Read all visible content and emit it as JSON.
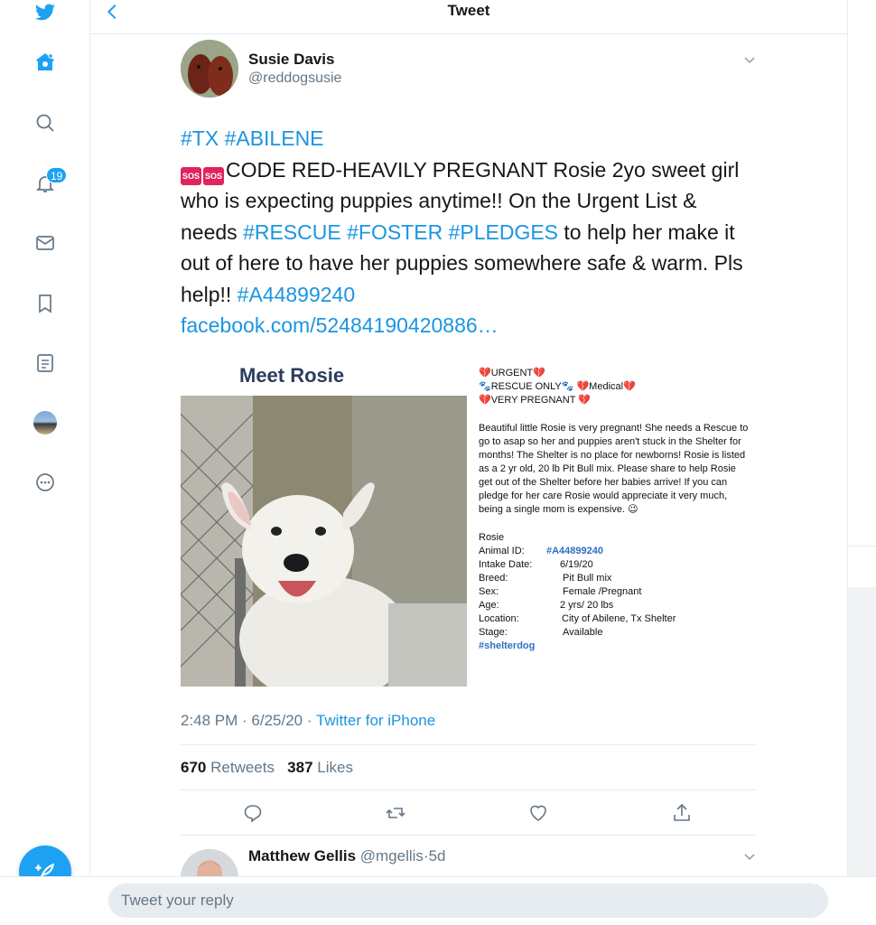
{
  "header": {
    "title": "Tweet"
  },
  "nav": {
    "notifications_count": "19"
  },
  "tweet": {
    "author_name": "Susie Davis",
    "author_handle": "@reddogsusie",
    "hashtags_line": "#TX #ABILENE",
    "sos": "SOS",
    "text_1": "CODE RED-HEAVILY PREGNANT Rosie 2yo sweet girl who is expecting puppies anytime!! On the Urgent List & needs ",
    "tag_rescue": "#RESCUE",
    "tag_foster": "#FOSTER",
    "tag_pledges": "#PLEDGES",
    "text_2": " to help her make it out of here to have her puppies somewhere safe & warm. Pls help!! ",
    "tag_id": "#A44899240",
    "link": "facebook.com/52484190420886…",
    "time": "2:48 PM · 6/25/20 · ",
    "source": "Twitter for iPhone",
    "retweets": "670",
    "retweets_label": "Retweets",
    "likes": "387",
    "likes_label": "Likes"
  },
  "media": {
    "title": "Meet Rosie",
    "urgent": "💔URGENT💔",
    "rescue_only": "🐾RESCUE  ONLY🐾      💔Medical💔",
    "very_pregnant": "💔VERY PREGNANT 💔",
    "description": "Beautiful  little Rosie is very pregnant!  She needs a Rescue  to go to asap so her and puppies aren't stuck in the Shelter  for months!  The Shelter  is  no place for newborns!  Rosie is listed as a 2 yr old, 20 lb Pit Bull mix.   Please share to help Rosie get out of the Shelter  before  her babies arrive!  If you can pledge for her care Rosie would appreciate  it  very much, being a single mom is expensive. 😉",
    "name": "Rosie",
    "rows": [
      {
        "k": "Animal ID:",
        "v": "#A44899240"
      },
      {
        "k": "Intake Date:",
        "v": "6/19/20"
      },
      {
        "k": "Breed:",
        "v": "Pit Bull mix"
      },
      {
        "k": "Sex:",
        "v": "Female /Pregnant"
      },
      {
        "k": "Age:",
        "v": "2 yrs/ 20 lbs"
      },
      {
        "k": "Location:",
        "v": "City of Abilene, Tx Shelter"
      },
      {
        "k": "Stage:",
        "v": "Available"
      }
    ],
    "tag": "#shelterdog"
  },
  "reply": {
    "name": "Matthew Gellis",
    "handle": "@mgellis",
    "time": "·5d"
  },
  "composer": {
    "placeholder": "Tweet your reply"
  },
  "colors": {
    "accent": "#1da1f2",
    "link": "#1b95e0",
    "muted": "#657786"
  }
}
